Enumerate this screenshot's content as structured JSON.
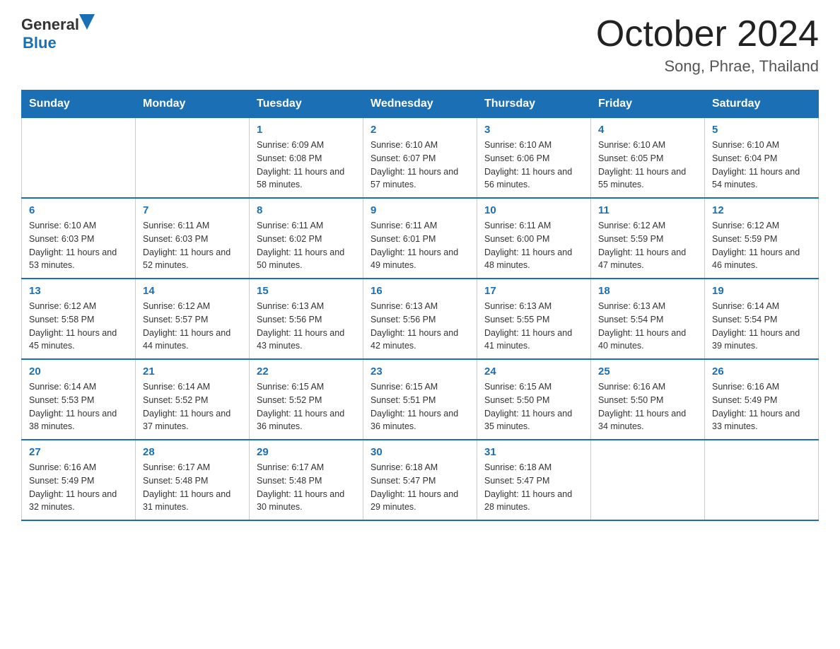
{
  "header": {
    "logo_general": "General",
    "logo_blue": "Blue",
    "month_title": "October 2024",
    "location": "Song, Phrae, Thailand"
  },
  "days_of_week": [
    "Sunday",
    "Monday",
    "Tuesday",
    "Wednesday",
    "Thursday",
    "Friday",
    "Saturday"
  ],
  "weeks": [
    [
      {
        "day": "",
        "sunrise": "",
        "sunset": "",
        "daylight": ""
      },
      {
        "day": "",
        "sunrise": "",
        "sunset": "",
        "daylight": ""
      },
      {
        "day": "1",
        "sunrise": "Sunrise: 6:09 AM",
        "sunset": "Sunset: 6:08 PM",
        "daylight": "Daylight: 11 hours and 58 minutes."
      },
      {
        "day": "2",
        "sunrise": "Sunrise: 6:10 AM",
        "sunset": "Sunset: 6:07 PM",
        "daylight": "Daylight: 11 hours and 57 minutes."
      },
      {
        "day": "3",
        "sunrise": "Sunrise: 6:10 AM",
        "sunset": "Sunset: 6:06 PM",
        "daylight": "Daylight: 11 hours and 56 minutes."
      },
      {
        "day": "4",
        "sunrise": "Sunrise: 6:10 AM",
        "sunset": "Sunset: 6:05 PM",
        "daylight": "Daylight: 11 hours and 55 minutes."
      },
      {
        "day": "5",
        "sunrise": "Sunrise: 6:10 AM",
        "sunset": "Sunset: 6:04 PM",
        "daylight": "Daylight: 11 hours and 54 minutes."
      }
    ],
    [
      {
        "day": "6",
        "sunrise": "Sunrise: 6:10 AM",
        "sunset": "Sunset: 6:03 PM",
        "daylight": "Daylight: 11 hours and 53 minutes."
      },
      {
        "day": "7",
        "sunrise": "Sunrise: 6:11 AM",
        "sunset": "Sunset: 6:03 PM",
        "daylight": "Daylight: 11 hours and 52 minutes."
      },
      {
        "day": "8",
        "sunrise": "Sunrise: 6:11 AM",
        "sunset": "Sunset: 6:02 PM",
        "daylight": "Daylight: 11 hours and 50 minutes."
      },
      {
        "day": "9",
        "sunrise": "Sunrise: 6:11 AM",
        "sunset": "Sunset: 6:01 PM",
        "daylight": "Daylight: 11 hours and 49 minutes."
      },
      {
        "day": "10",
        "sunrise": "Sunrise: 6:11 AM",
        "sunset": "Sunset: 6:00 PM",
        "daylight": "Daylight: 11 hours and 48 minutes."
      },
      {
        "day": "11",
        "sunrise": "Sunrise: 6:12 AM",
        "sunset": "Sunset: 5:59 PM",
        "daylight": "Daylight: 11 hours and 47 minutes."
      },
      {
        "day": "12",
        "sunrise": "Sunrise: 6:12 AM",
        "sunset": "Sunset: 5:59 PM",
        "daylight": "Daylight: 11 hours and 46 minutes."
      }
    ],
    [
      {
        "day": "13",
        "sunrise": "Sunrise: 6:12 AM",
        "sunset": "Sunset: 5:58 PM",
        "daylight": "Daylight: 11 hours and 45 minutes."
      },
      {
        "day": "14",
        "sunrise": "Sunrise: 6:12 AM",
        "sunset": "Sunset: 5:57 PM",
        "daylight": "Daylight: 11 hours and 44 minutes."
      },
      {
        "day": "15",
        "sunrise": "Sunrise: 6:13 AM",
        "sunset": "Sunset: 5:56 PM",
        "daylight": "Daylight: 11 hours and 43 minutes."
      },
      {
        "day": "16",
        "sunrise": "Sunrise: 6:13 AM",
        "sunset": "Sunset: 5:56 PM",
        "daylight": "Daylight: 11 hours and 42 minutes."
      },
      {
        "day": "17",
        "sunrise": "Sunrise: 6:13 AM",
        "sunset": "Sunset: 5:55 PM",
        "daylight": "Daylight: 11 hours and 41 minutes."
      },
      {
        "day": "18",
        "sunrise": "Sunrise: 6:13 AM",
        "sunset": "Sunset: 5:54 PM",
        "daylight": "Daylight: 11 hours and 40 minutes."
      },
      {
        "day": "19",
        "sunrise": "Sunrise: 6:14 AM",
        "sunset": "Sunset: 5:54 PM",
        "daylight": "Daylight: 11 hours and 39 minutes."
      }
    ],
    [
      {
        "day": "20",
        "sunrise": "Sunrise: 6:14 AM",
        "sunset": "Sunset: 5:53 PM",
        "daylight": "Daylight: 11 hours and 38 minutes."
      },
      {
        "day": "21",
        "sunrise": "Sunrise: 6:14 AM",
        "sunset": "Sunset: 5:52 PM",
        "daylight": "Daylight: 11 hours and 37 minutes."
      },
      {
        "day": "22",
        "sunrise": "Sunrise: 6:15 AM",
        "sunset": "Sunset: 5:52 PM",
        "daylight": "Daylight: 11 hours and 36 minutes."
      },
      {
        "day": "23",
        "sunrise": "Sunrise: 6:15 AM",
        "sunset": "Sunset: 5:51 PM",
        "daylight": "Daylight: 11 hours and 36 minutes."
      },
      {
        "day": "24",
        "sunrise": "Sunrise: 6:15 AM",
        "sunset": "Sunset: 5:50 PM",
        "daylight": "Daylight: 11 hours and 35 minutes."
      },
      {
        "day": "25",
        "sunrise": "Sunrise: 6:16 AM",
        "sunset": "Sunset: 5:50 PM",
        "daylight": "Daylight: 11 hours and 34 minutes."
      },
      {
        "day": "26",
        "sunrise": "Sunrise: 6:16 AM",
        "sunset": "Sunset: 5:49 PM",
        "daylight": "Daylight: 11 hours and 33 minutes."
      }
    ],
    [
      {
        "day": "27",
        "sunrise": "Sunrise: 6:16 AM",
        "sunset": "Sunset: 5:49 PM",
        "daylight": "Daylight: 11 hours and 32 minutes."
      },
      {
        "day": "28",
        "sunrise": "Sunrise: 6:17 AM",
        "sunset": "Sunset: 5:48 PM",
        "daylight": "Daylight: 11 hours and 31 minutes."
      },
      {
        "day": "29",
        "sunrise": "Sunrise: 6:17 AM",
        "sunset": "Sunset: 5:48 PM",
        "daylight": "Daylight: 11 hours and 30 minutes."
      },
      {
        "day": "30",
        "sunrise": "Sunrise: 6:18 AM",
        "sunset": "Sunset: 5:47 PM",
        "daylight": "Daylight: 11 hours and 29 minutes."
      },
      {
        "day": "31",
        "sunrise": "Sunrise: 6:18 AM",
        "sunset": "Sunset: 5:47 PM",
        "daylight": "Daylight: 11 hours and 28 minutes."
      },
      {
        "day": "",
        "sunrise": "",
        "sunset": "",
        "daylight": ""
      },
      {
        "day": "",
        "sunrise": "",
        "sunset": "",
        "daylight": ""
      }
    ]
  ]
}
